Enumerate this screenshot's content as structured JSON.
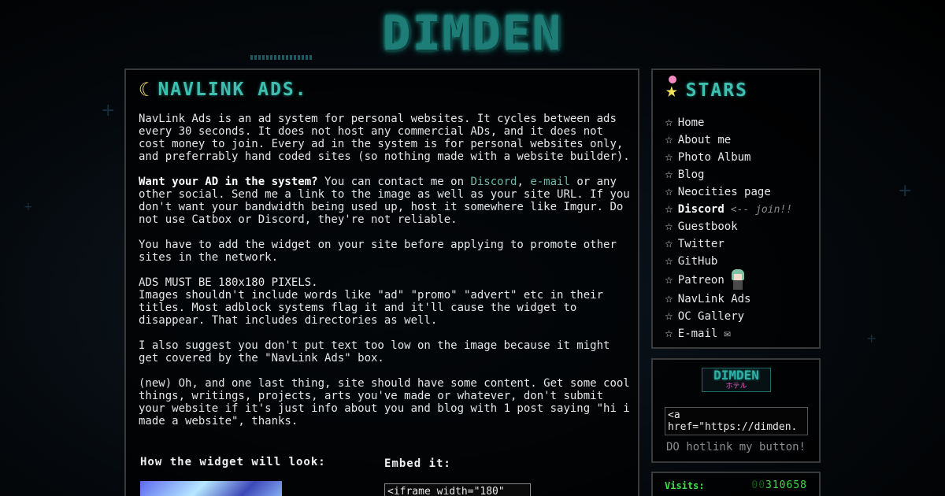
{
  "logo": {
    "text": "DIMDEN"
  },
  "main": {
    "title": "NAVLINK ADS.",
    "paragraphs": {
      "p1": "NavLink Ads is an ad system for personal websites. It cycles between ads every 30 seconds. It does not host any commercial ADs, and it does not cost money to join. Every ad in the system is for personal websites only, and preferrably hand coded sites (so nothing made with a website builder).",
      "p2_bold": "Want your AD in the system?",
      "p2_a": " You can contact me on ",
      "p2_discord": "Discord",
      "p2_comma": ", ",
      "p2_email": "e-mail",
      "p2_b": " or any other social. Send me a link to the image as well as your site URL. If you don't want your bandwidth being used up, host it somewhere like Imgur. Do not use Catbox or Discord, they're not reliable.",
      "p3": "You have to add the widget on your site before applying to promote other sites in the network.",
      "p4": "ADS MUST BE 180x180 PIXELS.\nImages shouldn't include words like \"ad\" \"promo\" \"advert\" etc in their titles. Most adblock systems flag it and it'll cause the widget to disappear. That includes directories as well.",
      "p5": "I also suggest you don't put text too low on the image because it might get covered by the \"NavLink Ads\" box.",
      "p6": "(new) Oh, and one last thing, site should have some content. Get some cool things, writings, projects, arts you've made or whatever, don't submit your website if it's just info about you and blog with 1 post saying \"hi i made a website\", thanks."
    },
    "widget_heading": "How the widget will look:",
    "embed_heading": "Embed it:",
    "embed_code": "<iframe width=\"180\""
  },
  "sidebar": {
    "stars_title": "STARS",
    "nav_items": [
      {
        "label": "Home"
      },
      {
        "label": "About me"
      },
      {
        "label": "Photo Album"
      },
      {
        "label": "Blog"
      },
      {
        "label": "Neocities page"
      },
      {
        "label": "Discord",
        "note": "<-- join!!"
      },
      {
        "label": "Guestbook"
      },
      {
        "label": "Twitter"
      },
      {
        "label": "GitHub"
      },
      {
        "label": "Patreon"
      },
      {
        "label": "NavLink Ads"
      },
      {
        "label": "OC Gallery"
      },
      {
        "label": "E-mail"
      }
    ],
    "button": {
      "logo_main": "DIMDEN",
      "logo_sub": "ホテル",
      "code": "<a\nhref=\"https://dimden.",
      "hotlink_note": "DO hotlink my button!"
    },
    "visits": {
      "label": "Visits:",
      "dim_digits": "00",
      "count": "310658"
    }
  },
  "colors": {
    "accent": "#3fbfb0",
    "link": "#6bb8a8",
    "counter": "#3ee04a"
  },
  "icons": {
    "title_icon": "moon-icon",
    "stars_icon": "star-icon",
    "bullet": "star-outline-icon",
    "mail": "envelope-icon"
  }
}
